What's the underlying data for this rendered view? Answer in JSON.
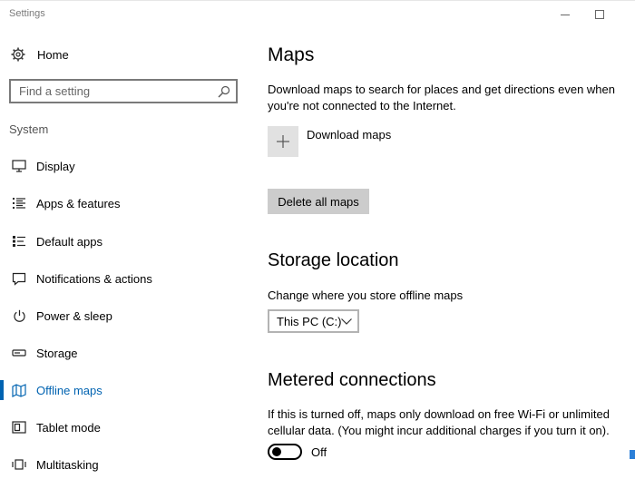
{
  "window": {
    "title": "Settings",
    "controls": {
      "minimize_icon": "minimize-icon",
      "maximize_icon": "maximize-icon"
    }
  },
  "sidebar": {
    "home": {
      "label": "Home",
      "icon": "gear-icon"
    },
    "search": {
      "placeholder": "Find a setting",
      "value": "",
      "icon": "search-icon"
    },
    "section_label": "System",
    "items": [
      {
        "label": "Display",
        "icon": "display-icon",
        "selected": false
      },
      {
        "label": "Apps & features",
        "icon": "apps-list-icon",
        "selected": false
      },
      {
        "label": "Default apps",
        "icon": "default-apps-icon",
        "selected": false
      },
      {
        "label": "Notifications & actions",
        "icon": "notification-icon",
        "selected": false
      },
      {
        "label": "Power & sleep",
        "icon": "power-icon",
        "selected": false
      },
      {
        "label": "Storage",
        "icon": "storage-icon",
        "selected": false
      },
      {
        "label": "Offline maps",
        "icon": "map-icon",
        "selected": true
      },
      {
        "label": "Tablet mode",
        "icon": "tablet-icon",
        "selected": false
      },
      {
        "label": "Multitasking",
        "icon": "multitasking-icon",
        "selected": false
      }
    ]
  },
  "main": {
    "title": "Maps",
    "description": "Download maps to search for places and get directions even when you're not connected to the Internet.",
    "download": {
      "label": "Download maps",
      "icon": "plus-icon"
    },
    "delete_button": "Delete all maps",
    "storage": {
      "heading": "Storage location",
      "label": "Change where you store offline maps",
      "selected": "This PC (C:)",
      "icon": "chevron-down-icon"
    },
    "metered": {
      "heading": "Metered connections",
      "description": "If this is turned off, maps only download on free Wi-Fi or unlimited cellular data. (You might incur additional charges if you turn it on).",
      "toggle_state": "Off",
      "toggle_on": false
    }
  },
  "colors": {
    "accent": "#0063b1",
    "button_bg": "#cccccc",
    "tile_bg": "#e1e1e1",
    "border": "#7a7a7a",
    "text": "#000000",
    "muted": "#555555"
  }
}
